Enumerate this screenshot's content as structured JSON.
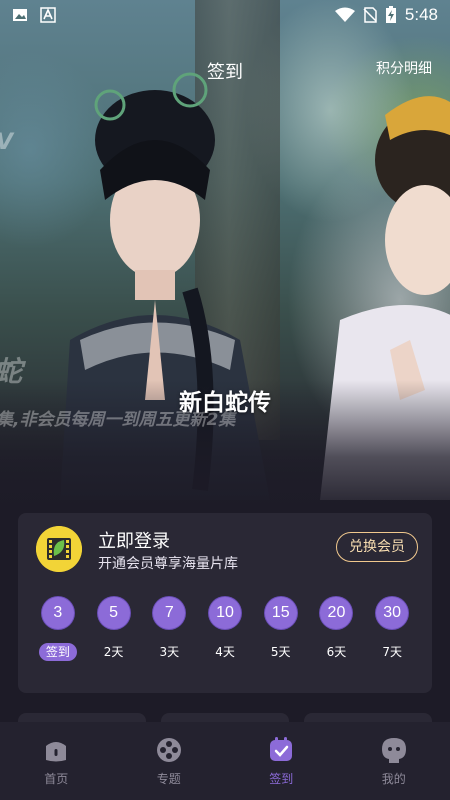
{
  "status_bar": {
    "time": "5:48"
  },
  "header": {
    "title": "签到",
    "points_detail": "积分明细"
  },
  "hero": {
    "caption": "新白蛇传",
    "overlay_top": "V",
    "overlay_big": "蛇",
    "overlay_text": "集,非会员每周一到周五更新2集"
  },
  "signin_card": {
    "login_title": "立即登录",
    "login_subtitle": "开通会员尊享海量片库",
    "redeem_button": "兑换会员",
    "days": [
      {
        "points": "3",
        "label": "签到"
      },
      {
        "points": "5",
        "label": "2天"
      },
      {
        "points": "7",
        "label": "3天"
      },
      {
        "points": "10",
        "label": "4天"
      },
      {
        "points": "15",
        "label": "5天"
      },
      {
        "points": "20",
        "label": "6天"
      },
      {
        "points": "30",
        "label": "7天"
      }
    ]
  },
  "bottom_nav": [
    {
      "label": "首页",
      "icon": "home-icon"
    },
    {
      "label": "专题",
      "icon": "film-reel-icon"
    },
    {
      "label": "签到",
      "icon": "checkin-icon",
      "active": true
    },
    {
      "label": "我的",
      "icon": "profile-icon"
    }
  ],
  "colors": {
    "accent": "#8c6bd8",
    "background": "#1d1b27",
    "card": "#2a2835",
    "gold": "#f1c98e"
  }
}
